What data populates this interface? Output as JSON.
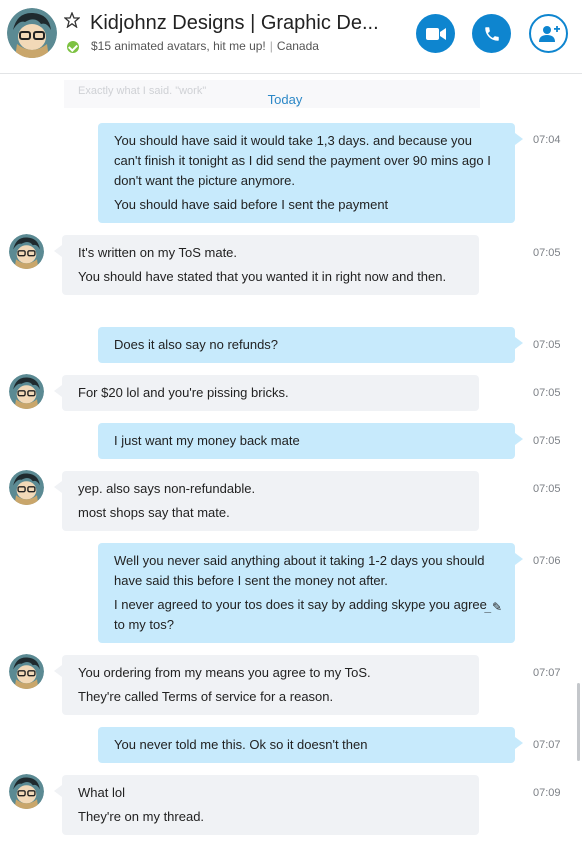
{
  "header": {
    "title": "Kidjohnz Designs | Graphic De...",
    "mood": "$15 animated avatars, hit me up!",
    "location": "Canada",
    "presence": "online",
    "accent_color": "#0e85cf"
  },
  "faded_text": "Exactly what I said. \"work\"",
  "day_separator": "Today",
  "messages": [
    {
      "dir": "out",
      "time": "07:04",
      "lines": [
        "You should have said it would take 1,3 days. and because you can't finish it tonight as I did send the payment over 90 mins ago I don't want the picture anymore.",
        "You should have said before I sent the payment"
      ]
    },
    {
      "dir": "in",
      "time": "07:05",
      "lines": [
        "It's written on my ToS mate.",
        "You should have stated that you wanted it in right now and then."
      ]
    },
    {
      "dir": "out",
      "time": "07:05",
      "lines": [
        "Does it also say no refunds?"
      ]
    },
    {
      "dir": "in",
      "time": "07:05",
      "lines": [
        "For $20 lol and you're pissing bricks."
      ]
    },
    {
      "dir": "out",
      "time": "07:05",
      "lines": [
        "I just want my money back mate"
      ]
    },
    {
      "dir": "in",
      "time": "07:05",
      "lines": [
        "yep. also says non-refundable.",
        "most shops say that mate."
      ]
    },
    {
      "dir": "out",
      "time": "07:06",
      "lines": [
        "Well you never said anything about it taking 1-2 days you should have said this before I sent the money not after.",
        "I never agreed to your tos does it say by adding skype you agree to my tos?"
      ],
      "edited_icon": "pencil-icon"
    },
    {
      "dir": "in",
      "time": "07:07",
      "lines": [
        "You ordering from my means you agree to my ToS.",
        "They're called Terms of service for a reason."
      ]
    },
    {
      "dir": "out",
      "time": "07:07",
      "lines": [
        "You never told me this. Ok so it doesn't then"
      ]
    },
    {
      "dir": "in",
      "time": "07:09",
      "lines": [
        "What lol",
        "They're on my thread."
      ]
    }
  ]
}
